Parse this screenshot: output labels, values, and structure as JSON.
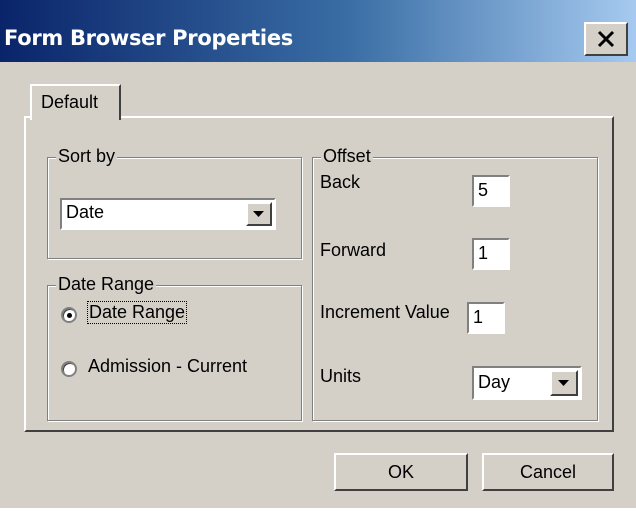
{
  "window": {
    "title": "Form Browser Properties",
    "close_icon": "close-icon"
  },
  "tabs": [
    {
      "label": "Default",
      "selected": true
    }
  ],
  "sort_by": {
    "legend": "Sort by",
    "selected": "Date"
  },
  "date_range": {
    "legend": "Date Range",
    "options": [
      {
        "label": "Date Range",
        "selected": true
      },
      {
        "label": "Admission - Current",
        "selected": false
      }
    ]
  },
  "offset": {
    "legend": "Offset",
    "back": {
      "label": "Back",
      "value": "5"
    },
    "forward": {
      "label": "Forward",
      "value": "1"
    },
    "increment": {
      "label": "Increment Value",
      "value": "1"
    },
    "units": {
      "label": "Units",
      "selected": "Day"
    }
  },
  "buttons": {
    "ok": "OK",
    "cancel": "Cancel"
  },
  "colors": {
    "face": "#d4d0c8",
    "title_start": "#0a246a",
    "title_end": "#a6caf0"
  }
}
